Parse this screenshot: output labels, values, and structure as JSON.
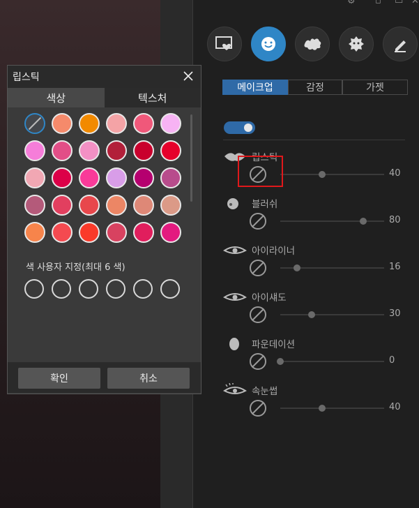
{
  "colors": {
    "accent": "#2f86c6",
    "tab_active": "#2f6aa7",
    "highlight": "#e0181b"
  },
  "mode_icons": [
    {
      "name": "frame-heart-icon",
      "active": false
    },
    {
      "name": "smile-face-icon",
      "active": true
    },
    {
      "name": "splash-icon",
      "active": false
    },
    {
      "name": "monster-icon",
      "active": false
    },
    {
      "name": "pen-icon",
      "active": false
    }
  ],
  "tabs": [
    {
      "label": "메이크업",
      "active": true
    },
    {
      "label": "감정",
      "active": false
    },
    {
      "label": "가젯",
      "active": false
    }
  ],
  "makeup_toggle": {
    "on": true
  },
  "features": [
    {
      "label": "립스틱",
      "value": "40",
      "level": 0.4,
      "icon": "lips-icon"
    },
    {
      "label": "블러쉬",
      "value": "80",
      "level": 0.8,
      "icon": "face-blush-icon"
    },
    {
      "label": "아이라이너",
      "value": "16",
      "level": 0.16,
      "icon": "eyeliner-icon"
    },
    {
      "label": "아이섀도",
      "value": "30",
      "level": 0.3,
      "icon": "eyeshadow-icon"
    },
    {
      "label": "파운데이션",
      "value": "0",
      "level": 0.0,
      "icon": "foundation-icon"
    },
    {
      "label": "속눈썹",
      "value": "40",
      "level": 0.4,
      "icon": "eyelash-icon"
    }
  ],
  "dialog": {
    "title": "립스틱",
    "tab_color": "색상",
    "tab_texture": "텍스처",
    "swatches": [
      "none",
      "#f58a6b",
      "#f28a00",
      "#f4a3a6",
      "#f0587a",
      "#f7b3f4",
      "#f67dd9",
      "#e24e87",
      "#f390c4",
      "#b2203a",
      "#c9002d",
      "#e6002b",
      "#f1a7b3",
      "#dc0048",
      "#f93a99",
      "#d89de8",
      "#b5006f",
      "#b84c8c",
      "#b45a7a",
      "#e23f5f",
      "#e8474c",
      "#ec8665",
      "#de8877",
      "#db9a87",
      "#f7844b",
      "#f44a50",
      "#fa3a2a",
      "#d84260",
      "#e11e5d",
      "#e31a7f"
    ],
    "custom_label": "색 사용자 지정(최대 6 색)",
    "custom_count": 6,
    "ok_label": "확인",
    "cancel_label": "취소"
  }
}
